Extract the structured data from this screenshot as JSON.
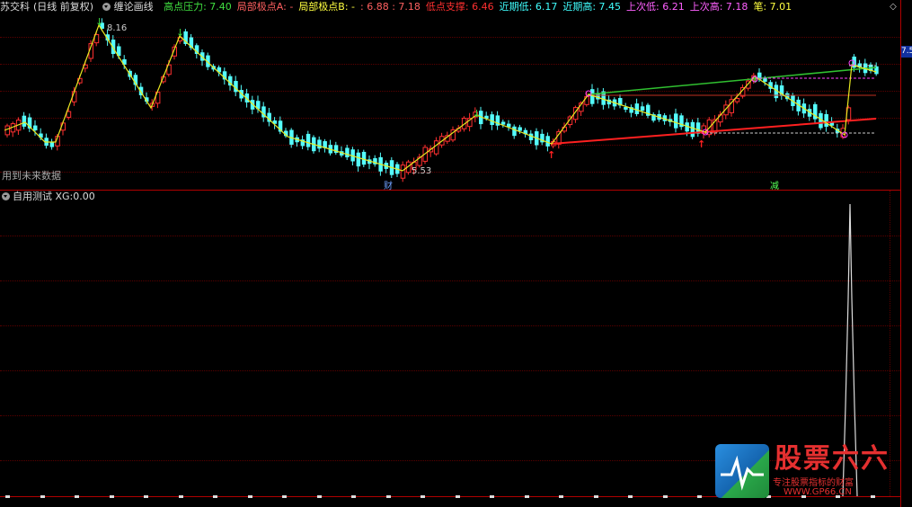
{
  "header": {
    "stock_name": "苏交科",
    "period": "(日线 前复权)",
    "indicator_name": "缠论画线",
    "items": [
      {
        "label": "高点压力:",
        "value": "7.40",
        "color": "#40e040"
      },
      {
        "label": "局部极点A:",
        "value": "-",
        "color": "#ff6060"
      },
      {
        "label": "局部极点B:",
        "value": "-",
        "color": "#ffff40"
      },
      {
        "label": ":",
        "value": "6.88 : 7.18",
        "color": "#ff6060"
      },
      {
        "label": "低点支撑:",
        "value": "6.46",
        "color": "#ff3030"
      },
      {
        "label": "近期低:",
        "value": "6.17",
        "color": "#40ffff"
      },
      {
        "label": "近期高:",
        "value": "7.45",
        "color": "#40ffff"
      },
      {
        "label": "上次低:",
        "value": "6.21",
        "color": "#ff60ff"
      },
      {
        "label": "上次高:",
        "value": "7.18",
        "color": "#ff60ff"
      },
      {
        "label": "笔:",
        "value": "7.01",
        "color": "#ffff40"
      }
    ]
  },
  "main_chart": {
    "high_label": "8.16",
    "low_label": "5.53",
    "future_data_note": "用到未来数据",
    "badge_cai": "财",
    "badge_jian": "减",
    "price_tag": "7.5"
  },
  "sub_chart": {
    "title": "自用测试",
    "xg_label": "XG:",
    "xg_value": "0.00"
  },
  "logo": {
    "title": "股票六六",
    "subtitle": "专注股票指标的财富",
    "url": "WWW.GP66.CN"
  },
  "colors": {
    "up": "#ff3030",
    "down": "#54fcfc",
    "zigzag": "#e8e820",
    "support": "#ff2020",
    "resistance": "#30c030",
    "magenta": "#ff40ff"
  },
  "chart_data": {
    "type": "candlestick",
    "pattern": "zigzag",
    "zigzag_pivots": [
      {
        "price": 6.05
      },
      {
        "price": 6.3
      },
      {
        "price": 6.1
      },
      {
        "price": 8.16
      },
      {
        "price": 7.15
      },
      {
        "price": 8.1
      },
      {
        "price": 6.1
      },
      {
        "price": 5.53
      },
      {
        "price": 6.7
      },
      {
        "price": 6.21
      },
      {
        "price": 7.18
      },
      {
        "price": 6.21
      },
      {
        "price": 7.4
      },
      {
        "price": 6.17
      },
      {
        "price": 7.45
      }
    ],
    "support_level": 6.46,
    "resistance_level": 7.4,
    "recent_low": 6.17,
    "recent_high": 7.45,
    "sub_indicator": {
      "name": "XG",
      "current": 0.0,
      "spike": 1
    }
  }
}
